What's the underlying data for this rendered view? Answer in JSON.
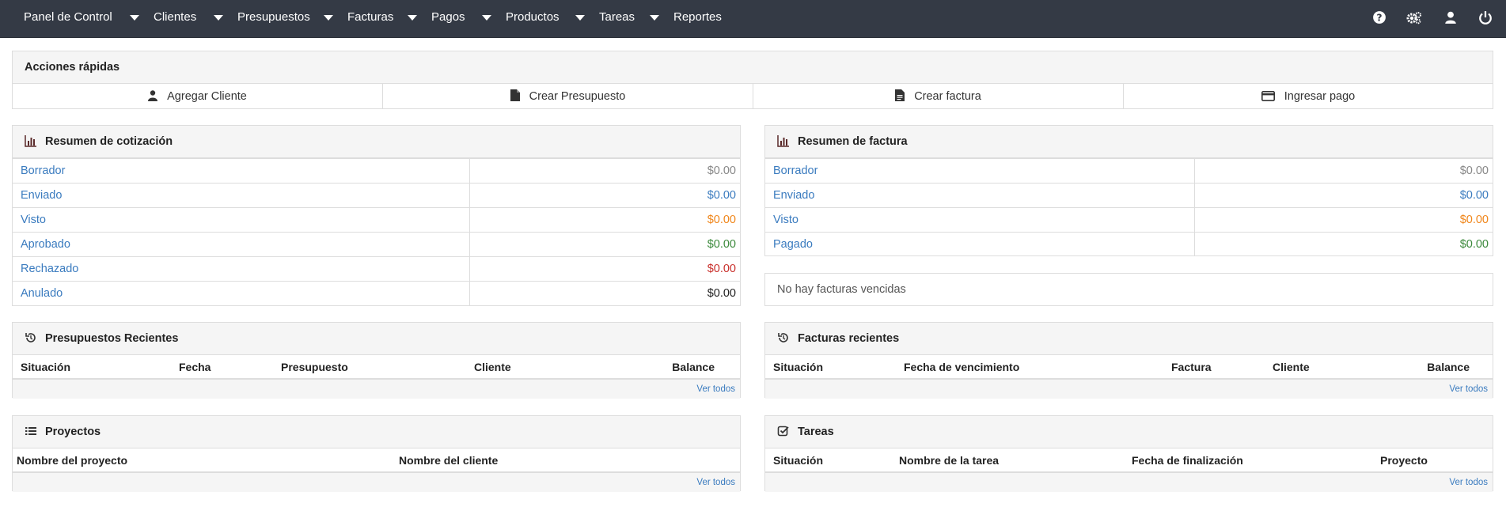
{
  "nav": {
    "brand": "Panel de Control",
    "items": [
      "Clientes",
      "Presupuestos",
      "Facturas",
      "Pagos",
      "Productos",
      "Tareas",
      "Reportes"
    ],
    "right_icons": [
      "help-icon",
      "settings-icon",
      "user-icon",
      "power-icon"
    ]
  },
  "quick_actions": {
    "title": "Acciones rápidas",
    "buttons": [
      {
        "label": "Agregar Cliente",
        "icon": "user-icon"
      },
      {
        "label": "Crear Presupuesto",
        "icon": "file-icon"
      },
      {
        "label": "Crear factura",
        "icon": "file-text-icon"
      },
      {
        "label": "Ingresar pago",
        "icon": "credit-card-icon"
      }
    ]
  },
  "quote_summary": {
    "title": "Resumen de cotización",
    "icon": "bar-chart-icon",
    "rows": [
      {
        "label": "Borrador",
        "value": "$0.00",
        "color": "#888888"
      },
      {
        "label": "Enviado",
        "value": "$0.00",
        "color": "#3a7bbf"
      },
      {
        "label": "Visto",
        "value": "$0.00",
        "color": "#f0861a"
      },
      {
        "label": "Aprobado",
        "value": "$0.00",
        "color": "#3c8a3c"
      },
      {
        "label": "Rechazado",
        "value": "$0.00",
        "color": "#c9302c"
      },
      {
        "label": "Anulado",
        "value": "$0.00",
        "color": "#222222"
      }
    ]
  },
  "invoice_summary": {
    "title": "Resumen de factura",
    "icon": "bar-chart-icon",
    "rows": [
      {
        "label": "Borrador",
        "value": "$0.00",
        "color": "#888888"
      },
      {
        "label": "Enviado",
        "value": "$0.00",
        "color": "#3a7bbf"
      },
      {
        "label": "Visto",
        "value": "$0.00",
        "color": "#f0861a"
      },
      {
        "label": "Pagado",
        "value": "$0.00",
        "color": "#3c8a3c"
      }
    ],
    "overdue_message": "No hay facturas vencidas"
  },
  "recent_quotes": {
    "title": "Presupuestos Recientes",
    "icon": "history-icon",
    "columns": [
      "Situación",
      "Fecha",
      "Presupuesto",
      "Cliente",
      "Balance"
    ],
    "see_all": "Ver todos"
  },
  "recent_invoices": {
    "title": "Facturas recientes",
    "icon": "history-icon",
    "columns": [
      "Situación",
      "Fecha de vencimiento",
      "Factura",
      "Cliente",
      "Balance"
    ],
    "see_all": "Ver todos"
  },
  "projects": {
    "title": "Proyectos",
    "icon": "list-icon",
    "columns": [
      "Nombre del proyecto",
      "Nombre del cliente"
    ],
    "see_all": "Ver todos"
  },
  "tasks": {
    "title": "Tareas",
    "icon": "check-square-icon",
    "columns": [
      "Situación",
      "Nombre de la tarea",
      "Fecha de finalización",
      "Proyecto"
    ],
    "see_all": "Ver todos"
  }
}
